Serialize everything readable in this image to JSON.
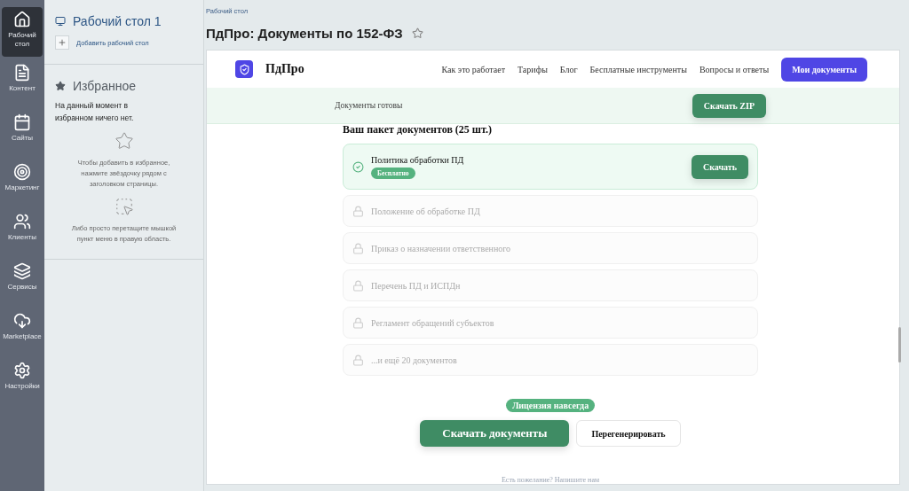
{
  "left_nav": [
    {
      "label": "Рабочий стол",
      "selected": true
    },
    {
      "label": "Контент",
      "selected": false
    },
    {
      "label": "Сайты",
      "selected": false
    },
    {
      "label": "Маркетинг",
      "selected": false
    },
    {
      "label": "Клиенты",
      "selected": false
    },
    {
      "label": "Сервисы",
      "selected": false
    },
    {
      "label": "Marketplace",
      "selected": false
    },
    {
      "label": "Настройки",
      "selected": false
    }
  ],
  "desktop_panel": {
    "title": "Рабочий стол 1",
    "add_label": "Добавить рабочий стол"
  },
  "favorites": {
    "title": "Избранное",
    "empty_text": "На данный момент в избранном ничего нет.",
    "hint_star": "Чтобы добавить в избранное, нажмите звёздочку рядом с заголовком страницы.",
    "hint_drag": "Либо просто перетащите мышкой пункт меню в правую область."
  },
  "breadcrumb": "Рабочий стол",
  "page_title": "ПдПро: Документы по 152-ФЗ",
  "site": {
    "logo": "ПдПро",
    "nav": [
      "Как это работает",
      "Тарифы",
      "Блог",
      "Бесплатные инструменты",
      "Вопросы и ответы"
    ],
    "cta": "Мои документы",
    "banner": {
      "text": "Документы готовы",
      "button": "Скачать ZIP"
    },
    "package_title": "Ваш пакет документов (25 шт.)",
    "documents": [
      {
        "kind": "available",
        "title": "Политика обработки ПД",
        "badge": "Бесплатно",
        "button": "Скачать"
      },
      {
        "kind": "locked",
        "title": "Положение об обработке ПД"
      },
      {
        "kind": "locked",
        "title": "Приказ о назначении ответственного"
      },
      {
        "kind": "locked",
        "title": "Перечень ПД и ИСПДн"
      },
      {
        "kind": "locked",
        "title": "Регламент обращений субъектов"
      },
      {
        "kind": "locked",
        "title": "...и ещё 20 документов"
      }
    ],
    "license_badge": "Лицензия навсегда",
    "primary_button": "Скачать документы",
    "secondary_button": "Перегенерировать",
    "footer": "Есть пожелание? Напишите нам"
  }
}
